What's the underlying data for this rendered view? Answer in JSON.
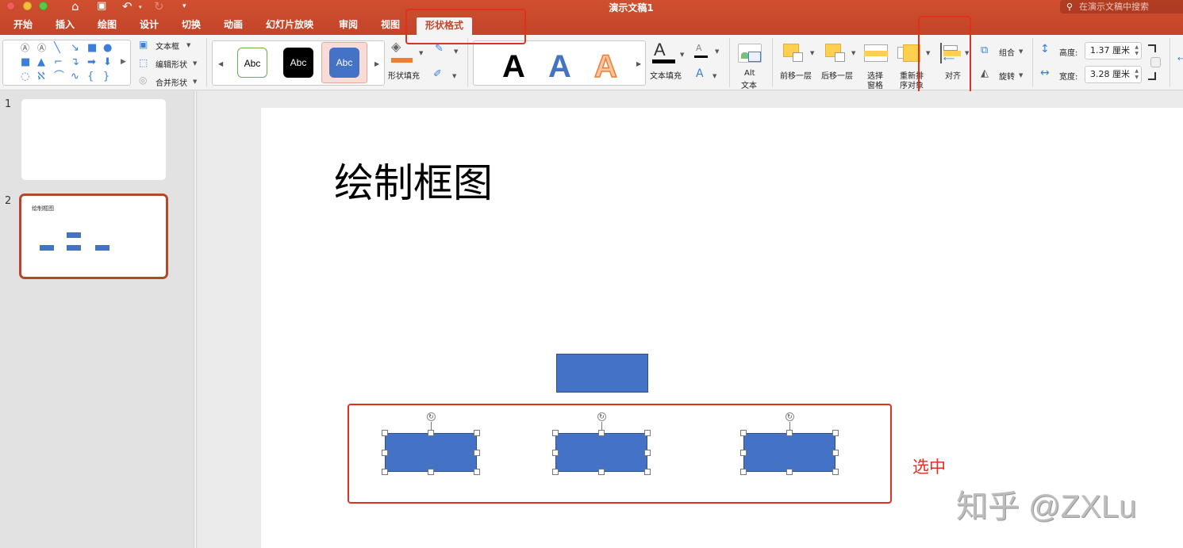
{
  "window": {
    "title": "演示文稿1",
    "search_placeholder": "在演示文稿中搜索",
    "quick_access": [
      "home-icon",
      "save-icon",
      "undo-icon",
      "redo-icon",
      "customize-icon"
    ]
  },
  "tabs": [
    {
      "label": "开始"
    },
    {
      "label": "插入"
    },
    {
      "label": "绘图"
    },
    {
      "label": "设计"
    },
    {
      "label": "切换"
    },
    {
      "label": "动画"
    },
    {
      "label": "幻灯片放映"
    },
    {
      "label": "审阅"
    },
    {
      "label": "视图"
    },
    {
      "label": "形状格式",
      "active": true
    }
  ],
  "ribbon": {
    "insert_shapes": {
      "textbox": "文本框",
      "edit_shape": "编辑形状",
      "merge_shapes": "合并形状"
    },
    "shape_styles": {
      "presets": [
        "Abc",
        "Abc",
        "Abc"
      ],
      "fill_label": "形状填充"
    },
    "wordart": {
      "presets": [
        "A",
        "A",
        "A"
      ],
      "text_fill_label": "文本填充"
    },
    "alt_text": {
      "line1": "Alt",
      "line2": "文本"
    },
    "arrange": {
      "bring_forward": "前移一层",
      "send_backward": "后移一层",
      "selection_pane_l1": "选择",
      "selection_pane_l2": "窗格",
      "reorder_l1": "重新排",
      "reorder_l2": "序对象",
      "align": "对齐",
      "group": "组合",
      "rotate": "旋转"
    },
    "size": {
      "height_label": "高度:",
      "height_value": "1.37 厘米",
      "width_label": "宽度:",
      "width_value": "3.28 厘米"
    }
  },
  "slides_panel": [
    {
      "number": "1",
      "title": ""
    },
    {
      "number": "2",
      "title": "绘制框图",
      "selected": true
    }
  ],
  "slide": {
    "title": "绘制框图",
    "annotation": "选中",
    "watermark": "知乎 @ZXLu"
  },
  "colors": {
    "accent": "#c4442a",
    "shape_fill": "#4472c4",
    "annotation_red": "#e0301e"
  }
}
